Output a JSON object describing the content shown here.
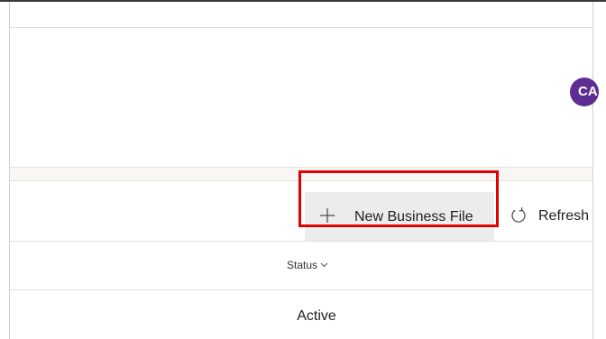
{
  "header": {
    "avatar_initials": "CA"
  },
  "toolbar": {
    "new_business_file_label": "New Business File",
    "refresh_label": "Refresh"
  },
  "grid": {
    "columns": [
      {
        "label": "Status"
      }
    ],
    "rows": [
      {
        "status": "Active"
      }
    ]
  },
  "icons": {
    "new": "plus-icon",
    "refresh": "refresh-icon",
    "sort": "chevron-down-icon"
  },
  "colors": {
    "avatar": "#5c2e91",
    "highlight": "#e00000",
    "button_hover": "#ececec"
  }
}
